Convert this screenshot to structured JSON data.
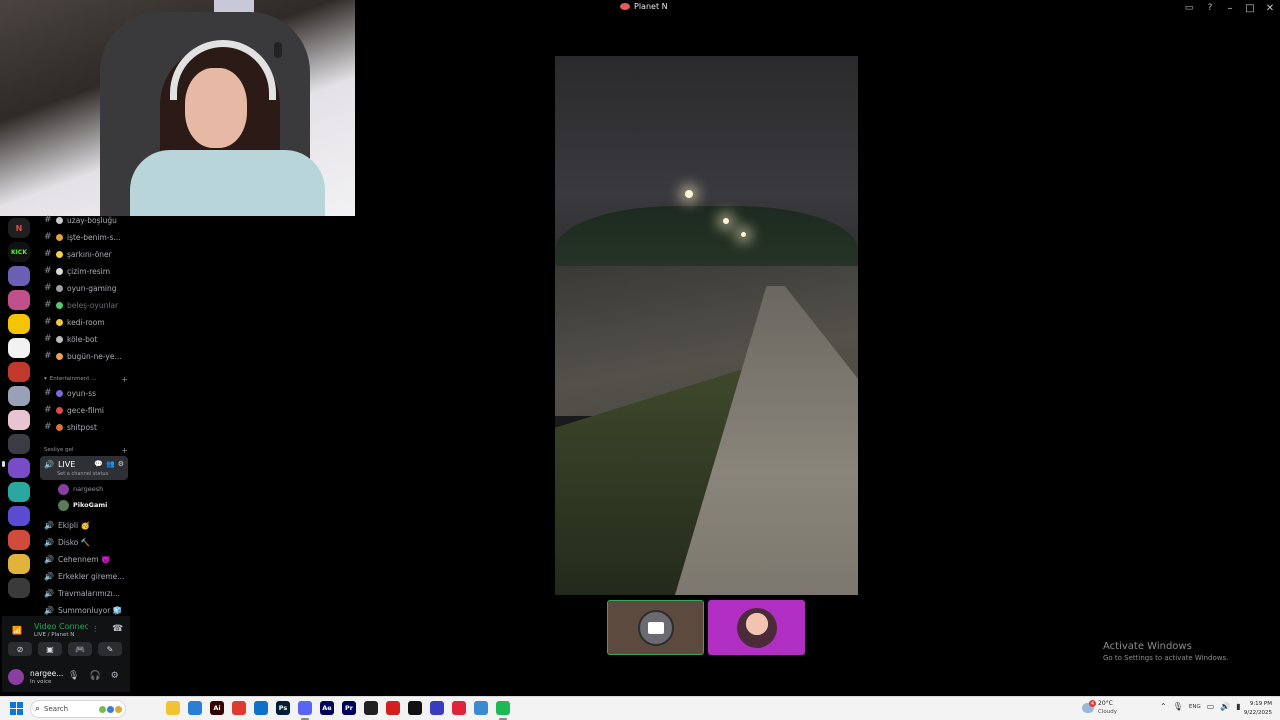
{
  "window": {
    "title": "Planet N",
    "icons": {
      "inbox": "▭",
      "help": "?",
      "minimize": "–",
      "maximize": "□",
      "close": "✕"
    }
  },
  "servers": [
    {
      "label": "N",
      "color": "#1f1f1f",
      "fg": "#e04a4a"
    },
    {
      "label": "KICK",
      "color": "#111111",
      "fg": "#53fc18"
    },
    {
      "label": "",
      "color": "#6b5fb5",
      "fg": "#fff"
    },
    {
      "label": "",
      "color": "#c0508a",
      "fg": "#fff"
    },
    {
      "label": "",
      "color": "#f5c400",
      "fg": "#111"
    },
    {
      "label": "",
      "color": "#f2f2f2",
      "fg": "#111"
    },
    {
      "label": "",
      "color": "#c0392b",
      "fg": "#fff"
    },
    {
      "label": "",
      "color": "#9aa0b5",
      "fg": "#fff"
    },
    {
      "label": "",
      "color": "#e7c3d4",
      "fg": "#111"
    },
    {
      "label": "",
      "color": "#3b3b44",
      "fg": "#fff"
    },
    {
      "label": "",
      "color": "#7a4bc7",
      "fg": "#fff"
    },
    {
      "label": "",
      "color": "#2aa8a0",
      "fg": "#fff"
    },
    {
      "label": "",
      "color": "#5a4bd0",
      "fg": "#fff"
    },
    {
      "label": "",
      "color": "#d04b3b",
      "fg": "#fff"
    },
    {
      "label": "",
      "color": "#e1b33b",
      "fg": "#111"
    },
    {
      "label": "",
      "color": "#3a3a3a",
      "fg": "#fff"
    }
  ],
  "text_channels": [
    {
      "name": "uzay-boşluğu",
      "emoji_color": "#c9c9c9"
    },
    {
      "name": "işte-benim-s...",
      "emoji_color": "#e6a23c"
    },
    {
      "name": "şarkını-öner",
      "emoji_color": "#f5d142"
    },
    {
      "name": "çizim-resim",
      "emoji_color": "#d9d9d9"
    },
    {
      "name": "oyun-gaming",
      "emoji_color": "#a0a0a0"
    },
    {
      "name": "beleş-oyunlar",
      "emoji_color": "#5bc96b",
      "muted": true
    },
    {
      "name": "kedi-room",
      "emoji_color": "#f2c744"
    },
    {
      "name": "köle-bot",
      "emoji_color": "#bbbbbb"
    },
    {
      "name": "bugün-ne-ye...",
      "emoji_color": "#f0a050"
    }
  ],
  "category_entertainment": {
    "label": "Entertainment ...",
    "plus": "+"
  },
  "entertainment_channels": [
    {
      "name": "oyun-ss",
      "emoji_color": "#7a6ad6"
    },
    {
      "name": "gece-filmi",
      "emoji_color": "#e24a4a"
    },
    {
      "name": "shitpost",
      "emoji_color": "#d8743a"
    }
  ],
  "category_voice": {
    "label": "Sesliye gel",
    "plus": "+"
  },
  "active_voice": {
    "name": "LIVE",
    "status_placeholder": "Set a channel status",
    "icons": [
      "💬",
      "👥",
      "⚙"
    ]
  },
  "voice_members": [
    {
      "name": "nargeesh",
      "color": "#8a3fa0",
      "dim": true
    },
    {
      "name": "PikoGami",
      "color": "#5a7a5a",
      "dim": false
    }
  ],
  "voice_channels": [
    {
      "name": "Ekipli 🥳"
    },
    {
      "name": "Disko 🔨"
    },
    {
      "name": "Cehennem 👿"
    },
    {
      "name": "Erkekler gireme..."
    },
    {
      "name": "Travmalarımızı..."
    },
    {
      "name": "Summonluyor 🧊"
    }
  ],
  "voice_panel": {
    "status": "Video Connected",
    "location": "LIVE / Planet N",
    "buttons": [
      "⊘",
      "▣",
      "🎮",
      "✎"
    ]
  },
  "user_panel": {
    "name": "nargee...",
    "status": "In voice"
  },
  "thumbnails": [
    {
      "label": "camera-participant"
    },
    {
      "label": "nargeesh-avatar"
    }
  ],
  "activate_windows": {
    "title": "Activate Windows",
    "subtitle": "Go to Settings to activate Windows."
  },
  "taskbar": {
    "search_placeholder": "Search",
    "apps": [
      {
        "label": "",
        "color": "#f0c430"
      },
      {
        "label": "",
        "color": "#2a7fd4"
      },
      {
        "label": "Ai",
        "color": "#330000"
      },
      {
        "label": "",
        "color": "#e03a2e"
      },
      {
        "label": "",
        "color": "#0f6fc9"
      },
      {
        "label": "Ps",
        "color": "#001e36"
      },
      {
        "label": "",
        "color": "#5865f2"
      },
      {
        "label": "Ae",
        "color": "#00005b"
      },
      {
        "label": "Pr",
        "color": "#00005b"
      },
      {
        "label": "",
        "color": "#202020"
      },
      {
        "label": "",
        "color": "#d51e1e"
      },
      {
        "label": "",
        "color": "#111111"
      },
      {
        "label": "",
        "color": "#3b3bbd"
      },
      {
        "label": "",
        "color": "#e0233b"
      },
      {
        "label": "",
        "color": "#3b8ad0"
      },
      {
        "label": "",
        "color": "#1db954"
      }
    ],
    "weather_temp": "20°C",
    "weather_desc": "Cloudy",
    "weather_badge": "4",
    "tray_lang": "ENG",
    "time": "9:19 PM",
    "date": "9/22/2025"
  }
}
